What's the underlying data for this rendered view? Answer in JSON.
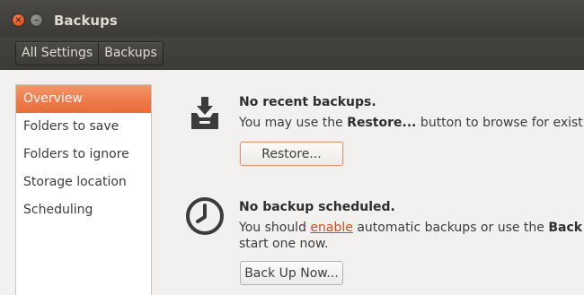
{
  "window": {
    "title": "Backups",
    "close_glyph": "×",
    "minimize_glyph": "–"
  },
  "toolbar": {
    "breadcrumbs": [
      "All Settings",
      "Backups"
    ]
  },
  "sidebar": {
    "items": [
      {
        "label": "Overview",
        "selected": true
      },
      {
        "label": "Folders to save",
        "selected": false
      },
      {
        "label": "Folders to ignore",
        "selected": false
      },
      {
        "label": "Storage location",
        "selected": false
      },
      {
        "label": "Scheduling",
        "selected": false
      }
    ]
  },
  "overview": {
    "backups": {
      "icon": "backup-restore-icon",
      "title": "No recent backups.",
      "text_prefix": "You may use the ",
      "text_bold": "Restore...",
      "text_suffix": " button to browse for existing",
      "button_label": "Restore..."
    },
    "schedule": {
      "icon": "clock-icon",
      "title": "No backup scheduled.",
      "text_prefix": "You should ",
      "link_label": "enable",
      "text_middle": " automatic backups or use the ",
      "text_bold": "Back Up",
      "text_line2": "start one now.",
      "button_label": "Back Up Now..."
    }
  },
  "colors": {
    "accent": "#e96d39",
    "link": "#dd4814",
    "chrome": "#3c3b37"
  }
}
